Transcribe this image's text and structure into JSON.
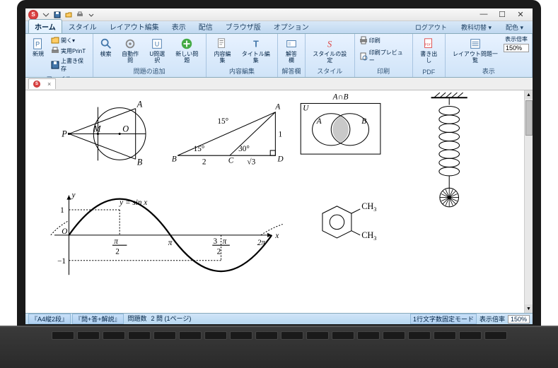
{
  "app": {
    "icon_letter": "S"
  },
  "window_controls": {
    "min": "—",
    "max": "☐",
    "close": "✕"
  },
  "tabs": {
    "items": [
      "ホーム",
      "スタイル",
      "レイアウト編集",
      "表示",
      "配信",
      "ブラウザ版",
      "オプション"
    ],
    "active_index": 0,
    "right": [
      "ログアウト",
      "教科切替 ▾",
      "配色 ▾"
    ]
  },
  "ribbon": {
    "groups": [
      {
        "label": "ファイル",
        "big": [
          {
            "name": "new-button",
            "icon": "doc-p",
            "label": "新規"
          }
        ],
        "small": [
          {
            "name": "open-menu",
            "icon": "folder",
            "label": "開く▾"
          },
          {
            "name": "print-util",
            "icon": "print-sm",
            "label": "実用PrinT"
          },
          {
            "name": "overwrite-save",
            "icon": "save",
            "label": "上書き保存"
          }
        ]
      },
      {
        "label": "問題の追加",
        "big": [
          {
            "name": "search-button",
            "icon": "search",
            "label": "検索"
          },
          {
            "name": "auto-create",
            "icon": "gear",
            "label": "自動作問"
          },
          {
            "name": "select-problem",
            "icon": "select-u",
            "label": "U問選択"
          },
          {
            "name": "new-problem",
            "icon": "plus-round",
            "label": "新しい問題"
          }
        ]
      },
      {
        "label": "内容編集",
        "big": [
          {
            "name": "edit-content",
            "icon": "edit-doc",
            "label": "内容編集"
          },
          {
            "name": "edit-title",
            "icon": "title-t",
            "label": "タイトル編集"
          }
        ]
      },
      {
        "label": "解答欄",
        "big": [
          {
            "name": "answer-field",
            "icon": "answer",
            "label": "解答欄"
          }
        ]
      },
      {
        "label": "スタイル",
        "big": [
          {
            "name": "style-settings",
            "icon": "style-s",
            "label": "スタイルの設定"
          }
        ]
      },
      {
        "label": "印刷",
        "small2": [
          {
            "name": "print-button",
            "icon": "printer",
            "label": "印刷"
          },
          {
            "name": "print-preview",
            "icon": "preview",
            "label": "印刷プレビュー"
          }
        ]
      },
      {
        "label": "PDF",
        "big": [
          {
            "name": "export-pdf",
            "icon": "pdf",
            "label": "書き出し"
          }
        ]
      },
      {
        "label": "表示",
        "big": [
          {
            "name": "layout-list",
            "icon": "list",
            "label": "レイアウト問題一覧"
          }
        ],
        "zoom": {
          "label": "表示倍率",
          "value": "150%"
        }
      }
    ]
  },
  "doctab": {
    "close": "×"
  },
  "statusbar": {
    "segA": "『A4縦2段』",
    "segB": "『問+答+解説』",
    "count_label": "問題数",
    "count_value": "2 問 (1ページ)",
    "mode": "1行文字数固定モード",
    "zoom_label": "表示倍率",
    "zoom_value": "150%"
  },
  "figures": {
    "circle": {
      "P": "P",
      "M": "M",
      "O": "O",
      "A": "A",
      "B": "B"
    },
    "triangle": {
      "A": "A",
      "B": "B",
      "C": "C",
      "D": "D",
      "a15a": "15°",
      "a15b": "15°",
      "a30": "30°",
      "len2": "2",
      "lenr3": "√3",
      "len1": "1"
    },
    "venn": {
      "title": "A∩B",
      "U": "U",
      "A": "A",
      "B": "B"
    },
    "sine": {
      "eq": "y = sin x",
      "y": "y",
      "x": "x",
      "O": "O",
      "one": "1",
      "neg1": "−1",
      "pi2": "π",
      "pi2d": "2",
      "pi": "π",
      "threepi2n": "3",
      "threepi2d": "2",
      "threepi2m": "π",
      "twopi": "2π"
    },
    "chem": {
      "ch3a": "CH",
      "sub3a": "3",
      "ch3b": "CH",
      "sub3b": "3"
    }
  }
}
